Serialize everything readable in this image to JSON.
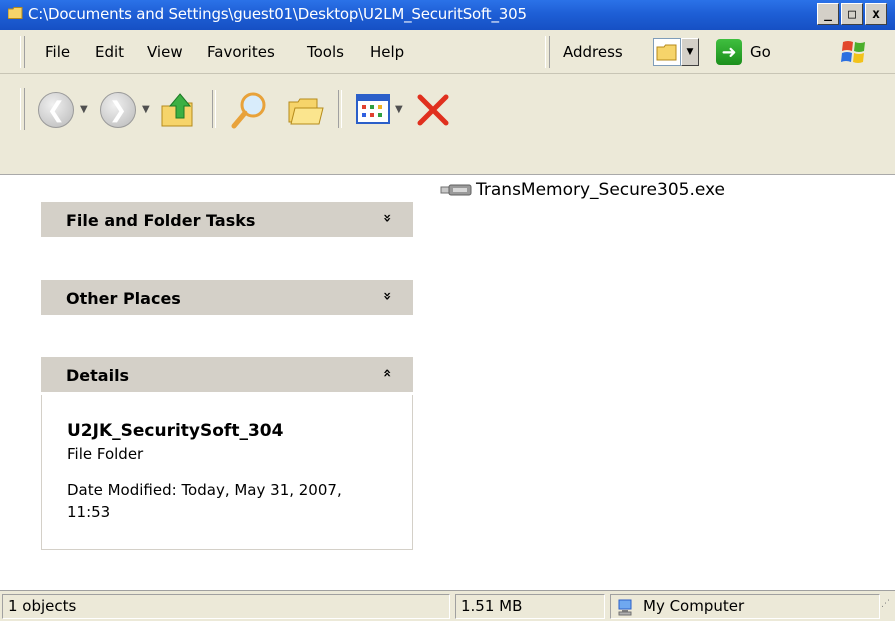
{
  "window": {
    "title": "C:\\Documents and Settings\\guest01\\Desktop\\U2LM_SecuritSoft_305",
    "minimize": "_",
    "maximize": "□",
    "close": "x"
  },
  "menu": {
    "items": [
      "File",
      "Edit",
      "View",
      "Favorites",
      "Tools",
      "Help"
    ],
    "address_label": "Address",
    "go_label": "Go"
  },
  "toolbar": {
    "icons": [
      "back-icon",
      "forward-icon",
      "up-folder-icon",
      "search-icon",
      "folders-icon",
      "views-icon",
      "delete-icon"
    ]
  },
  "taskpane": {
    "sections": [
      {
        "title": "File and Folder Tasks",
        "state": "collapsed",
        "chevron": "»"
      },
      {
        "title": "Other Places",
        "state": "collapsed",
        "chevron": "»"
      },
      {
        "title": "Details",
        "state": "expanded",
        "chevron": "«"
      }
    ],
    "details": {
      "name": "U2JK_SecuritySoft_304",
      "type": "File Folder",
      "date_modified": "Date Modified: Today, May 31, 2007, 11:53"
    }
  },
  "files": [
    {
      "name": "TransMemory_Secure305.exe",
      "icon": "usb-drive-icon"
    }
  ],
  "statusbar": {
    "objects": "1 objects",
    "size": "1.51 MB",
    "location": "My Computer"
  },
  "colors": {
    "titlebar": "#1e5fd6",
    "chrome": "#ece9d8",
    "pane_header": "#d4d0c8"
  }
}
